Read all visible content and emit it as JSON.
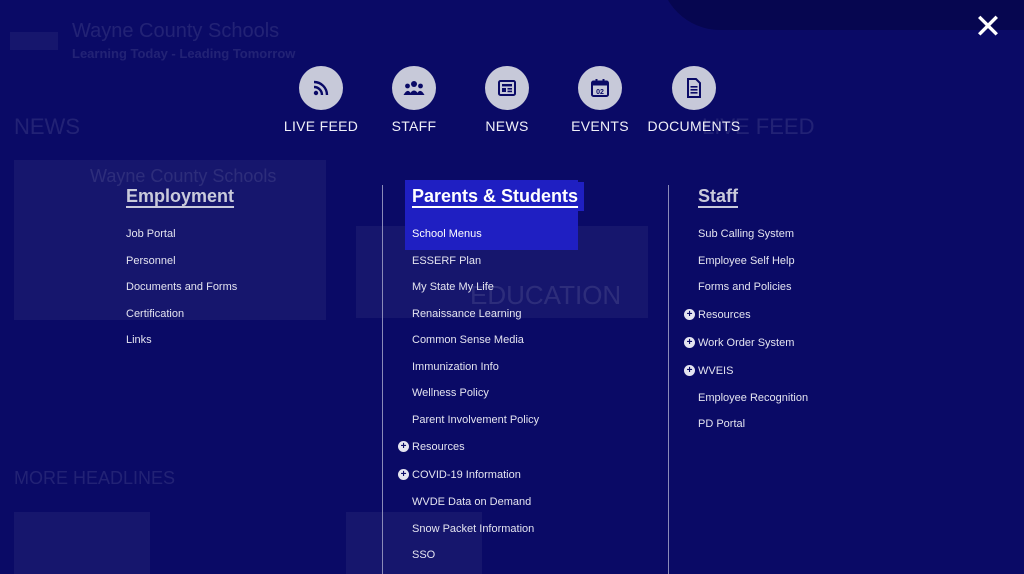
{
  "background": {
    "site_title": "Wayne County Schools",
    "tagline": "Learning Today - Leading Tomorrow",
    "news_heading": "NEWS",
    "live_feed_heading": "LIVE FEED",
    "more_headlines": "MORE HEADLINES",
    "card_title": "Wayne County Schools",
    "card2_title": "EDUCATION"
  },
  "close": {
    "icon": "close-icon",
    "label": "✕"
  },
  "quick_links": [
    {
      "label": "LIVE FEED",
      "icon": "rss-icon"
    },
    {
      "label": "STAFF",
      "icon": "people-icon"
    },
    {
      "label": "NEWS",
      "icon": "newspaper-icon"
    },
    {
      "label": "EVENTS",
      "icon": "calendar-icon",
      "badge": "02"
    },
    {
      "label": "DOCUMENTS",
      "icon": "document-icon"
    }
  ],
  "columns": {
    "employment": {
      "heading": "Employment",
      "items": [
        "Job Portal",
        "Personnel",
        "Documents and Forms",
        "Certification",
        "Links"
      ]
    },
    "parents": {
      "heading": "Parents & Students",
      "items": [
        "School Menus",
        "ESSERF Plan",
        "My State My Life",
        "Renaissance Learning",
        "Common Sense Media",
        "Immunization Info",
        "Wellness Policy",
        "Parent Involvement Policy",
        "Resources",
        "COVID-19 Information",
        "WVDE Data on Demand",
        "Snow Packet Information",
        "SSO"
      ]
    },
    "staff": {
      "heading": "Staff",
      "items": [
        "Sub Calling System",
        "Employee Self Help",
        "Forms and Policies",
        "Resources",
        "Work Order System",
        "WVEIS",
        "Employee Recognition",
        "PD Portal"
      ]
    }
  },
  "colors": {
    "overlay": "#0a0a66",
    "active_highlight": "#1f1fc2",
    "icon_circle": "#c7c9d9"
  }
}
